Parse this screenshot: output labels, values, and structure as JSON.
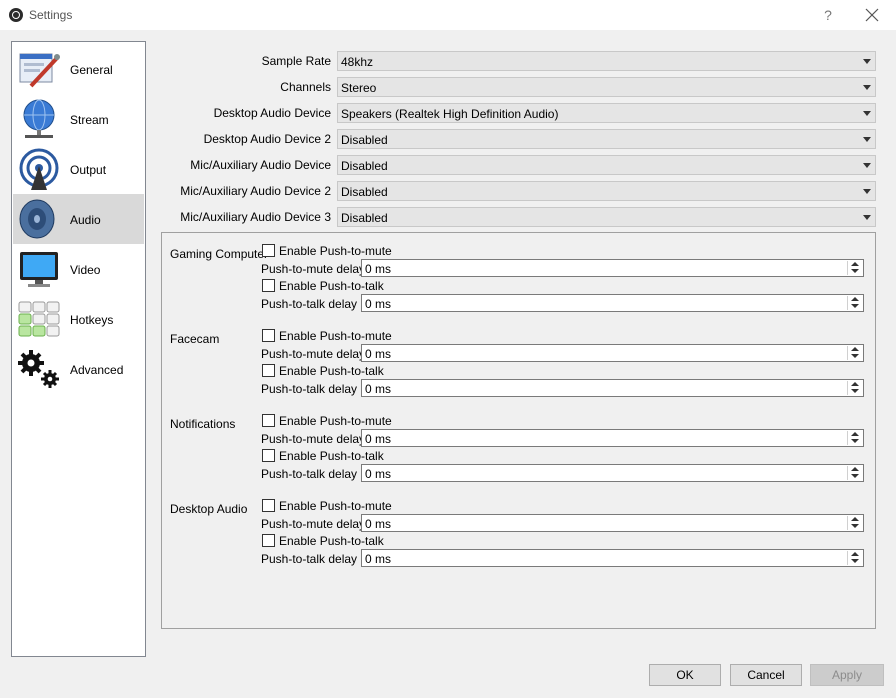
{
  "window": {
    "title": "Settings",
    "help_label": "?"
  },
  "sidebar": {
    "items": [
      {
        "label": "General",
        "icon": "general-icon"
      },
      {
        "label": "Stream",
        "icon": "stream-icon"
      },
      {
        "label": "Output",
        "icon": "output-icon"
      },
      {
        "label": "Audio",
        "icon": "audio-icon",
        "selected": true
      },
      {
        "label": "Video",
        "icon": "video-icon"
      },
      {
        "label": "Hotkeys",
        "icon": "hotkeys-icon"
      },
      {
        "label": "Advanced",
        "icon": "advanced-icon"
      }
    ]
  },
  "audio": {
    "fields": [
      {
        "label": "Sample Rate",
        "value": "48khz"
      },
      {
        "label": "Channels",
        "value": "Stereo"
      },
      {
        "label": "Desktop Audio Device",
        "value": "Speakers (Realtek High Definition Audio)"
      },
      {
        "label": "Desktop Audio Device 2",
        "value": "Disabled"
      },
      {
        "label": "Mic/Auxiliary Audio Device",
        "value": "Disabled"
      },
      {
        "label": "Mic/Auxiliary Audio Device 2",
        "value": "Disabled"
      },
      {
        "label": "Mic/Auxiliary Audio Device 3",
        "value": "Disabled"
      }
    ],
    "hotkey_sources": [
      {
        "name": "Gaming Computer",
        "push_to_mute_label": "Enable Push-to-mute",
        "push_to_mute_checked": false,
        "mute_delay_label": "Push-to-mute delay",
        "mute_delay": "0 ms",
        "push_to_talk_label": "Enable Push-to-talk",
        "push_to_talk_checked": false,
        "talk_delay_label": "Push-to-talk delay",
        "talk_delay": "0 ms"
      },
      {
        "name": "Facecam",
        "push_to_mute_label": "Enable Push-to-mute",
        "push_to_mute_checked": false,
        "mute_delay_label": "Push-to-mute delay",
        "mute_delay": "0 ms",
        "push_to_talk_label": "Enable Push-to-talk",
        "push_to_talk_checked": false,
        "talk_delay_label": "Push-to-talk delay",
        "talk_delay": "0 ms"
      },
      {
        "name": "Notifications",
        "push_to_mute_label": "Enable Push-to-mute",
        "push_to_mute_checked": false,
        "mute_delay_label": "Push-to-mute delay",
        "mute_delay": "0 ms",
        "push_to_talk_label": "Enable Push-to-talk",
        "push_to_talk_checked": false,
        "talk_delay_label": "Push-to-talk delay",
        "talk_delay": "0 ms"
      },
      {
        "name": "Desktop Audio",
        "push_to_mute_label": "Enable Push-to-mute",
        "push_to_mute_checked": false,
        "mute_delay_label": "Push-to-mute delay",
        "mute_delay": "0 ms",
        "push_to_talk_label": "Enable Push-to-talk",
        "push_to_talk_checked": false,
        "talk_delay_label": "Push-to-talk delay",
        "talk_delay": "0 ms"
      }
    ]
  },
  "buttons": {
    "ok": "OK",
    "cancel": "Cancel",
    "apply": "Apply",
    "apply_enabled": false
  }
}
